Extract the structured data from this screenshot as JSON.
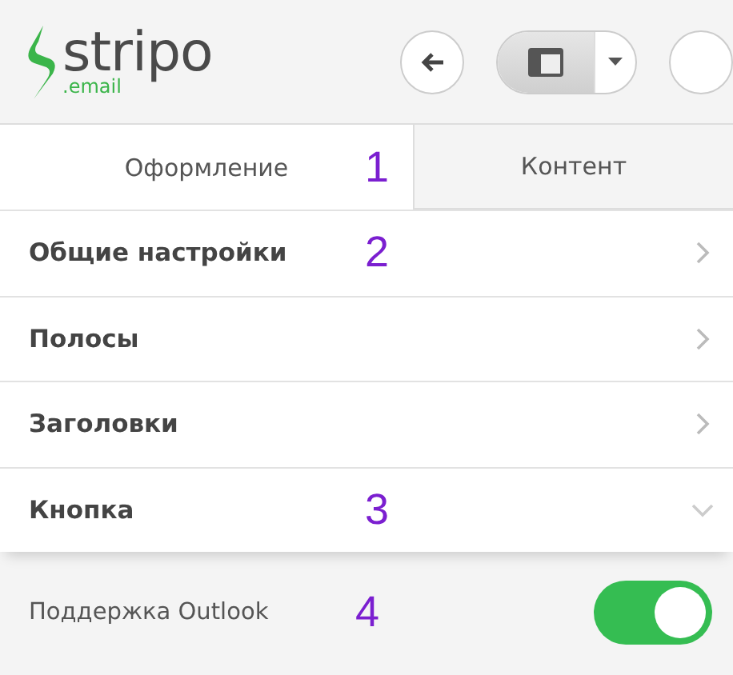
{
  "header": {
    "logo": {
      "name": "stripo",
      "suffix": ".email"
    },
    "buttons": [
      {
        "kind": "back",
        "selected": false
      },
      {
        "kind": "layout",
        "selected": true
      },
      {
        "kind": "partial",
        "selected": false
      }
    ]
  },
  "tabs": [
    {
      "label": "Оформление",
      "selected": true,
      "annotation": "1"
    },
    {
      "label": "Контент",
      "selected": false
    }
  ],
  "sections": [
    {
      "label": "Общие настройки",
      "expanded": false,
      "annotation": "2"
    },
    {
      "label": "Полосы",
      "expanded": false
    },
    {
      "label": "Заголовки",
      "expanded": false
    },
    {
      "label": "Кнопка",
      "expanded": true,
      "annotation": "3"
    }
  ],
  "settings": [
    {
      "label": "Поддержка Outlook",
      "on": true,
      "annotation": "4"
    }
  ]
}
